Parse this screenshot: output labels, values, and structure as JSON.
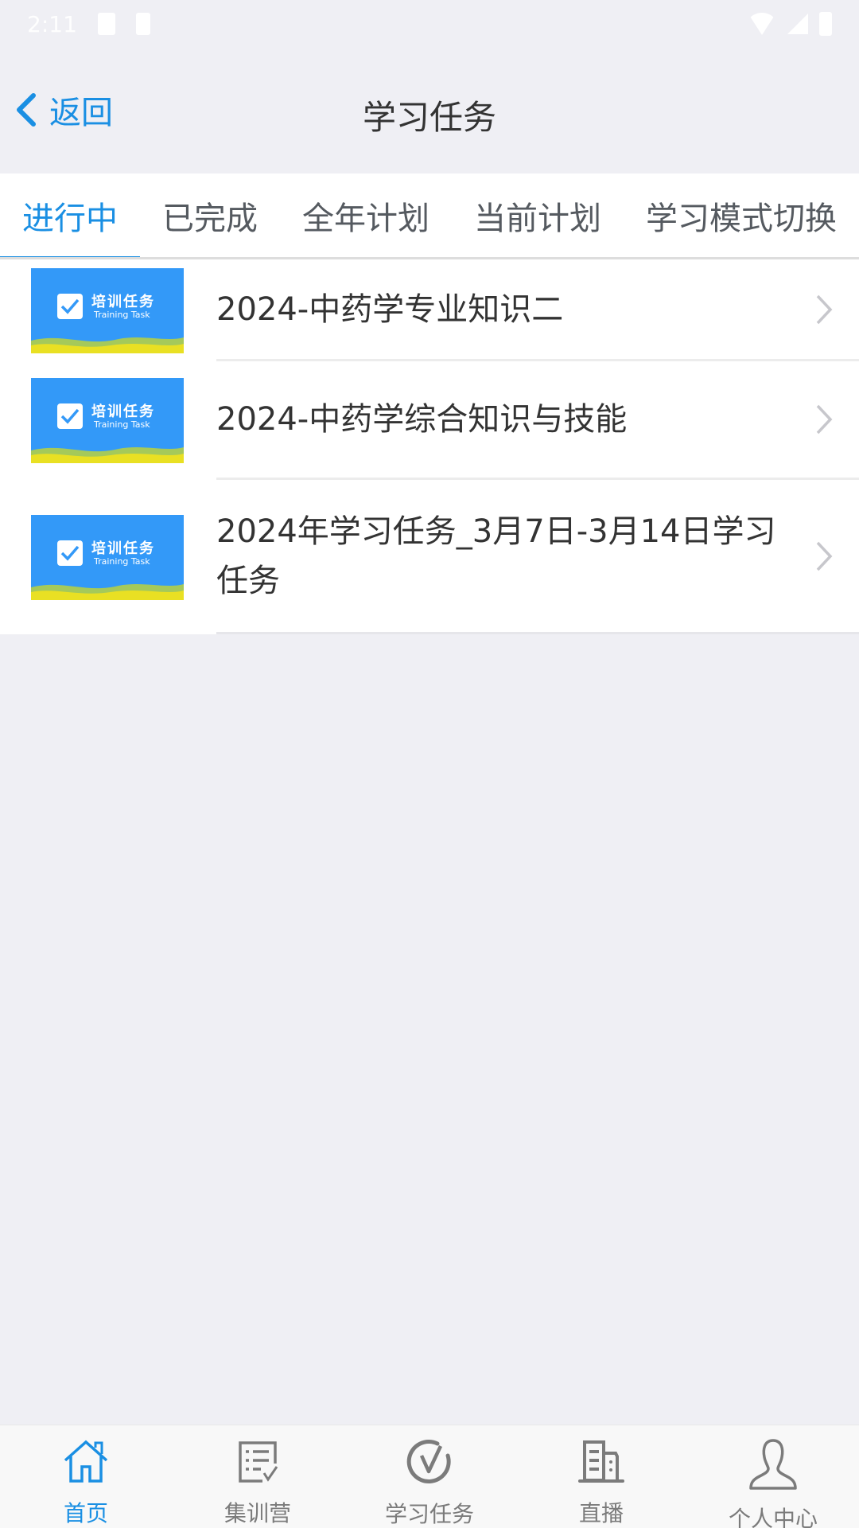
{
  "status_bar": {
    "time": "2:11"
  },
  "nav": {
    "back_label": "返回",
    "title": "学习任务"
  },
  "colors": {
    "accent": "#1a8fe3",
    "text_primary": "#333333",
    "text_secondary": "#7b7b7b",
    "background": "#efeff4"
  },
  "tabs": [
    {
      "label": "进行中",
      "active": true
    },
    {
      "label": "已完成",
      "active": false
    },
    {
      "label": "全年计划",
      "active": false
    },
    {
      "label": "当前计划",
      "active": false
    },
    {
      "label": "学习模式切换",
      "active": false
    }
  ],
  "thumbnail": {
    "title_cn": "培训任务",
    "title_en": "Training Task"
  },
  "tasks": [
    {
      "title": "2024-中药学专业知识二"
    },
    {
      "title": "2024-中药学综合知识与技能"
    },
    {
      "title": "2024年学习任务_3月7日-3月14日学习任务"
    }
  ],
  "bottom_nav": [
    {
      "label": "首页",
      "icon": "home-icon",
      "active": true
    },
    {
      "label": "集训营",
      "icon": "checklist-icon",
      "active": false
    },
    {
      "label": "学习任务",
      "icon": "check-circle-icon",
      "active": false
    },
    {
      "label": "直播",
      "icon": "building-icon",
      "active": false
    },
    {
      "label": "个人中心",
      "icon": "person-icon",
      "active": false
    }
  ]
}
